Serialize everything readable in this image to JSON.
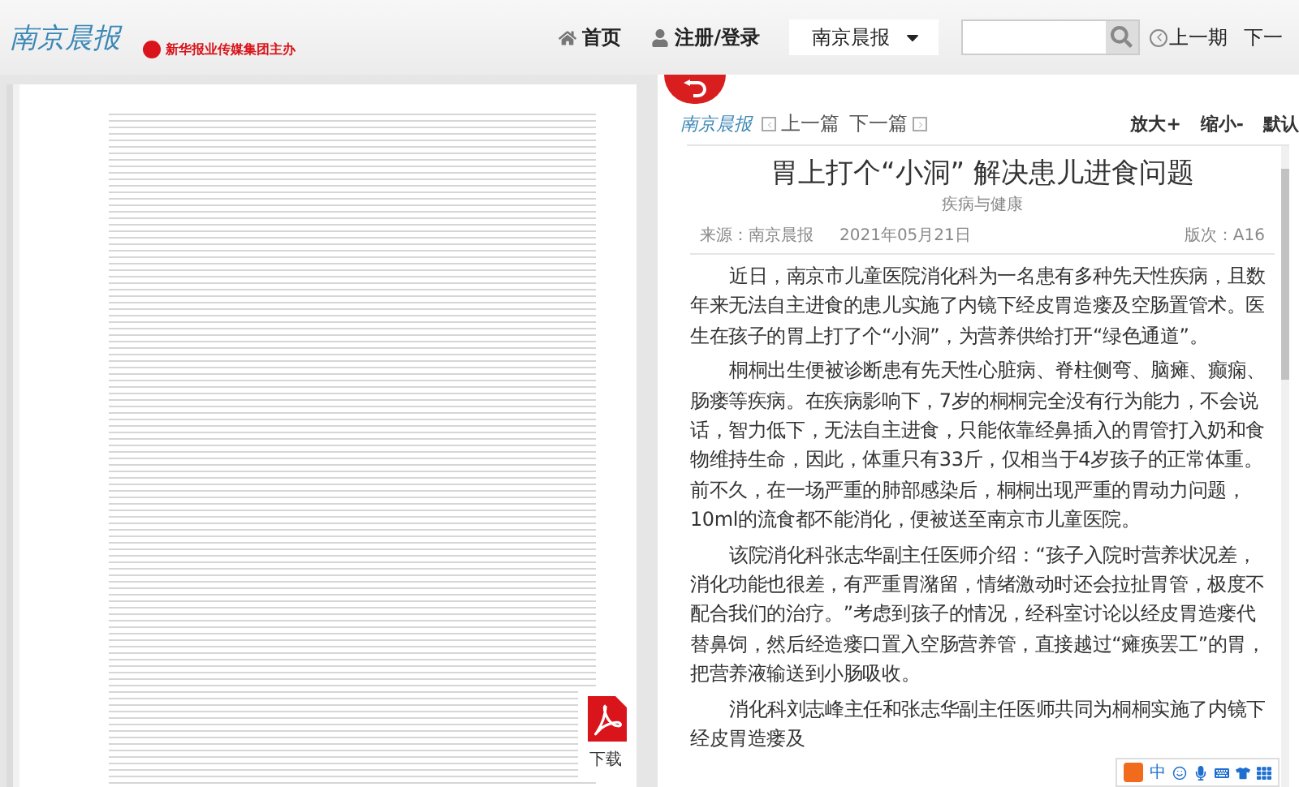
{
  "header": {
    "logo": "南京晨报",
    "sponsor": "新华报业传媒集团主办",
    "nav": [
      {
        "kind": "home",
        "label": "首页"
      },
      {
        "kind": "user",
        "label": "注册/登录"
      }
    ],
    "edition_select": "南京晨报",
    "issue_nav": [
      {
        "kind": "prev",
        "label": "上一期"
      },
      {
        "kind": "next",
        "label": "下一"
      }
    ]
  },
  "download": {
    "label": "下载"
  },
  "article": {
    "logo": "南京晨报",
    "prev": "上一篇",
    "next": "下一篇",
    "zoom": [
      "放大+",
      "缩小-",
      "默认"
    ],
    "title": "胃上打个“小洞” 解决患儿进食问题",
    "section": "疾病与健康",
    "source": "来源：南京晨报",
    "date": "2021年05月21日",
    "page": "版次：A16",
    "paragraphs": [
      "近日，南京市儿童医院消化科为一名患有多种先天性疾病，且数年来无法自主进食的患儿实施了内镜下经皮胃造瘘及空肠置管术。医生在孩子的胃上打了个“小洞”，为营养供给打开“绿色通道”。",
      "桐桐出生便被诊断患有先天性心脏病、脊柱侧弯、脑瘫、癫痫、肠瘘等疾病。在疾病影响下，7岁的桐桐完全没有行为能力，不会说话，智力低下，无法自主进食，只能依靠经鼻插入的胃管打入奶和食物维持生命，因此，体重只有33斤，仅相当于4岁孩子的正常体重。前不久，在一场严重的肺部感染后，桐桐出现严重的胃动力问题，10ml的流食都不能消化，便被送至南京市儿童医院。",
      "该院消化科张志华副主任医师介绍：“孩子入院时营养状况差，消化功能也很差，有严重胃潴留，情绪激动时还会拉扯胃管，极度不配合我们的治疗。”考虑到孩子的情况，经科室讨论以经皮胃造瘘代替鼻饲，然后经造瘘口置入空肠营养管，直接越过“瘫痪罢工”的胃，把营养液输送到小肠吸收。",
      "消化科刘志峰主任和张志华副主任医师共同为桐桐实施了内镜下经皮胃造瘘及"
    ]
  },
  "ime_toolbar": {
    "mode": "中"
  }
}
